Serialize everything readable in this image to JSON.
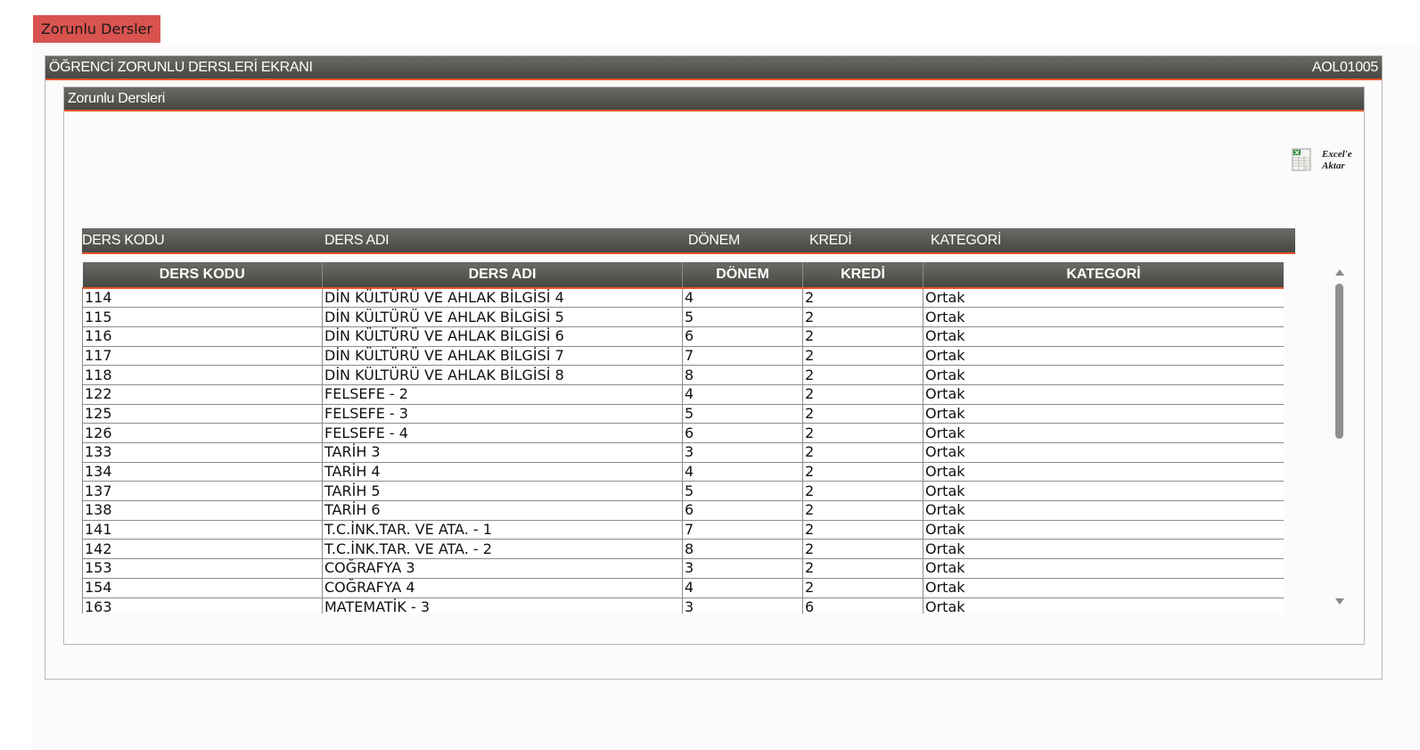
{
  "tab": {
    "label": "Zorunlu Dersler"
  },
  "outer_panel": {
    "title": "ÖĞRENCİ ZORUNLU DERSLERİ EKRANI",
    "code": "AOL01005"
  },
  "inner_panel": {
    "title": "Zorunlu Dersleri"
  },
  "excel_export": {
    "label": "Excel'e Aktar",
    "icon": "excel-spreadsheet-icon"
  },
  "column_bar": [
    "DERS KODU",
    "DERS ADI",
    "DÖNEM",
    "KREDİ",
    "KATEGORİ"
  ],
  "grid": {
    "headers": [
      "DERS KODU",
      "DERS ADI",
      "DÖNEM",
      "KREDİ",
      "KATEGORİ"
    ],
    "rows": [
      [
        "114",
        "DİN KÜLTÜRÜ VE AHLAK BİLGİSİ 4",
        "4",
        "2",
        "Ortak"
      ],
      [
        "115",
        "DİN KÜLTÜRÜ VE AHLAK BİLGİSİ 5",
        "5",
        "2",
        "Ortak"
      ],
      [
        "116",
        "DİN KÜLTÜRÜ VE AHLAK BİLGİSİ 6",
        "6",
        "2",
        "Ortak"
      ],
      [
        "117",
        "DİN KÜLTÜRÜ VE AHLAK BİLGİSİ 7",
        "7",
        "2",
        "Ortak"
      ],
      [
        "118",
        "DİN KÜLTÜRÜ VE AHLAK BİLGİSİ 8",
        "8",
        "2",
        "Ortak"
      ],
      [
        "122",
        "FELSEFE - 2",
        "4",
        "2",
        "Ortak"
      ],
      [
        "125",
        "FELSEFE - 3",
        "5",
        "2",
        "Ortak"
      ],
      [
        "126",
        "FELSEFE - 4",
        "6",
        "2",
        "Ortak"
      ],
      [
        "133",
        "TARİH 3",
        "3",
        "2",
        "Ortak"
      ],
      [
        "134",
        "TARİH 4",
        "4",
        "2",
        "Ortak"
      ],
      [
        "137",
        "TARİH 5",
        "5",
        "2",
        "Ortak"
      ],
      [
        "138",
        "TARİH 6",
        "6",
        "2",
        "Ortak"
      ],
      [
        "141",
        "T.C.İNK.TAR. VE ATA. - 1",
        "7",
        "2",
        "Ortak"
      ],
      [
        "142",
        "T.C.İNK.TAR. VE ATA. - 2",
        "8",
        "2",
        "Ortak"
      ],
      [
        "153",
        "COĞRAFYA 3",
        "3",
        "2",
        "Ortak"
      ],
      [
        "154",
        "COĞRAFYA 4",
        "4",
        "2",
        "Ortak"
      ],
      [
        "163",
        "MATEMATİK - 3",
        "3",
        "6",
        "Ortak"
      ]
    ]
  },
  "colors": {
    "tab": "#d9534f",
    "header_dark": "#4a4a46",
    "accent_line": "#e8542a"
  }
}
